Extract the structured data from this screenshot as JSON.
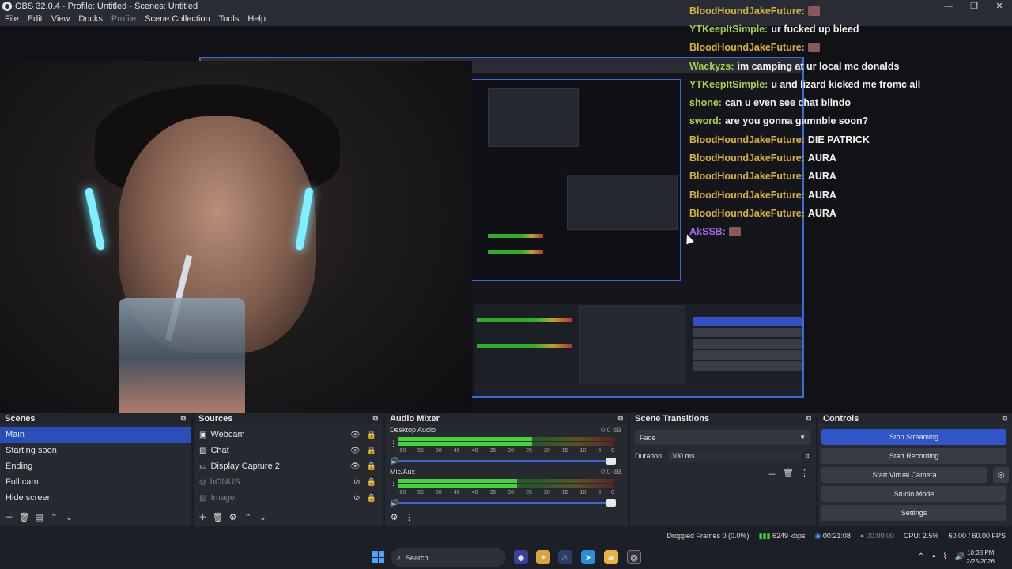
{
  "window": {
    "title": "OBS 32.0.4 - Profile: Untitled - Scenes: Untitled",
    "controls": [
      "—",
      "❐",
      "✕"
    ]
  },
  "menu": [
    "File",
    "Edit",
    "View",
    "Docks",
    "Profile",
    "Scene Collection",
    "Tools",
    "Help"
  ],
  "chat": [
    {
      "user": "BloodHoundJakeFuture:",
      "text": "",
      "color": "#d6b33a",
      "emote": true
    },
    {
      "user": "YTKeepItSimple:",
      "text": "ur fucked up bleed",
      "color": "#a7d14a",
      "emote": false
    },
    {
      "user": "BloodHoundJakeFuture:",
      "text": "",
      "color": "#d6b33a",
      "emote": true
    },
    {
      "user": "Wackyzs:",
      "text": "im camping at ur local mc donalds",
      "color": "#a7d14a",
      "emote": false
    },
    {
      "user": "YTKeepItSimple:",
      "text": "u and lizard kicked me fromc all",
      "color": "#a7d14a",
      "emote": false
    },
    {
      "user": "shone:",
      "text": "can u even see chat blindo",
      "color": "#a7d14a",
      "emote": false
    },
    {
      "user": "sword:",
      "text": "are you gonna gamnble soon?",
      "color": "#a7d14a",
      "emote": false
    },
    {
      "user": "BloodHoundJakeFuture:",
      "text": "DIE PATRICK",
      "color": "#d6b33a",
      "emote": false
    },
    {
      "user": "BloodHoundJakeFuture:",
      "text": "AURA",
      "color": "#d6b33a",
      "emote": false
    },
    {
      "user": "BloodHoundJakeFuture:",
      "text": "AURA",
      "color": "#d6b33a",
      "emote": false
    },
    {
      "user": "BloodHoundJakeFuture:",
      "text": "AURA",
      "color": "#d6b33a",
      "emote": false
    },
    {
      "user": "BloodHoundJakeFuture:",
      "text": "AURA",
      "color": "#d6b33a",
      "emote": false
    },
    {
      "user": "AkSSB:",
      "text": "",
      "color": "#a264e8",
      "emote": true
    }
  ],
  "scenes": {
    "title": "Scenes",
    "items": [
      "Main",
      "Starting soon",
      "Ending",
      "Full cam",
      "Hide screen"
    ],
    "selected": 0
  },
  "sources": {
    "title": "Sources",
    "items": [
      {
        "label": "Webcam",
        "visible": true,
        "icon": "camera-icon"
      },
      {
        "label": "Chat",
        "visible": true,
        "icon": "image-icon"
      },
      {
        "label": "Display Capture 2",
        "visible": true,
        "icon": "monitor-icon"
      },
      {
        "label": "bONUS",
        "visible": false,
        "icon": "globe-icon"
      },
      {
        "label": "Image",
        "visible": false,
        "icon": "image-icon"
      }
    ]
  },
  "mixer": {
    "title": "Audio Mixer",
    "channels": [
      {
        "name": "Desktop Audio",
        "db": "0.0 dB",
        "level": 0.62
      },
      {
        "name": "Mic/Aux",
        "db": "0.0 dB",
        "level": 0.55
      }
    ],
    "ticks": [
      "-60",
      "-55",
      "-50",
      "-45",
      "-40",
      "-35",
      "-30",
      "-25",
      "-20",
      "-15",
      "-10",
      "-5",
      "0"
    ]
  },
  "transitions": {
    "title": "Scene Transitions",
    "selected": "Fade",
    "duration_label": "Duration",
    "duration_value": "300 ms"
  },
  "controls": {
    "title": "Controls",
    "buttons": [
      "Stop Streaming",
      "Start Recording",
      "Start Virtual Camera",
      "Studio Mode",
      "Settings"
    ]
  },
  "status": {
    "dropped": "Dropped Frames 0 (0.0%)",
    "bitrate": "6249 kbps",
    "stream_time": "00:21:08",
    "rec_time": "00:00:00",
    "cpu": "CPU: 2.5%",
    "fps": "60.00 / 60.00 FPS"
  },
  "taskbar": {
    "search": "Search",
    "time": "10:38 PM",
    "date": "2/25/2026"
  }
}
